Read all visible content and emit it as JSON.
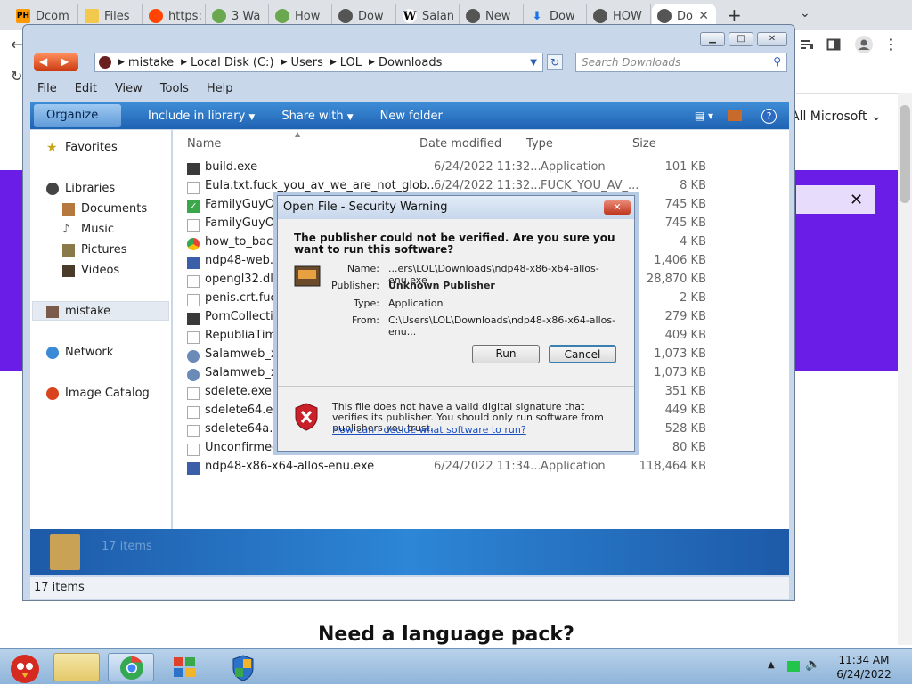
{
  "browser": {
    "tabs": [
      {
        "label": "Dcom",
        "fav": "PH",
        "color": "#ff9900"
      },
      {
        "label": "Files",
        "fav": "folder",
        "color": "#f2c94c"
      },
      {
        "label": "https:",
        "fav": "reddit",
        "color": "#ff4500"
      },
      {
        "label": "3 Wa",
        "fav": "wh",
        "color": "#6aa84f"
      },
      {
        "label": "How",
        "fav": "wh",
        "color": "#6aa84f"
      },
      {
        "label": "Dow",
        "fav": "globe",
        "color": "#555555"
      },
      {
        "label": "Salan",
        "fav": "W",
        "color": "#ffffff"
      },
      {
        "label": "New",
        "fav": "globe",
        "color": "#555555"
      },
      {
        "label": "Dow",
        "fav": "download",
        "color": "#1a73e8"
      },
      {
        "label": "HOW",
        "fav": "globe",
        "color": "#555555"
      },
      {
        "label": "Do",
        "fav": "globe",
        "color": "#555555",
        "active": true
      }
    ],
    "new_tab": "+",
    "page": {
      "all_microsoft": "All Microsoft",
      "banner_close": "✕",
      "language_pack": "Need a language pack?"
    }
  },
  "explorer": {
    "breadcrumb": [
      "mistake",
      "Local Disk (C:)",
      "Users",
      "LOL",
      "Downloads"
    ],
    "search_placeholder": "Search Downloads",
    "menu": [
      "File",
      "Edit",
      "View",
      "Tools",
      "Help"
    ],
    "toolbar": {
      "organize": "Organize",
      "include": "Include in library",
      "share": "Share with",
      "new_folder": "New folder"
    },
    "nav": {
      "favorites": "Favorites",
      "libraries": "Libraries",
      "documents": "Documents",
      "music": "Music",
      "pictures": "Pictures",
      "videos": "Videos",
      "mistake": "mistake",
      "network": "Network",
      "image_catalog": "Image Catalog"
    },
    "columns": {
      "name": "Name",
      "date": "Date modified",
      "type": "Type",
      "size": "Size"
    },
    "files": [
      {
        "name": "build.exe",
        "date": "6/24/2022 11:32...",
        "type": "Application",
        "size": "101 KB"
      },
      {
        "name": "Eula.txt.fuck_you_av_we_are_not_glob...",
        "date": "6/24/2022 11:32...",
        "type": "FUCK_YOU_AV_...",
        "size": "8 KB"
      },
      {
        "name": "FamilyGuyOpt",
        "date": "",
        "type": "",
        "size": "745 KB"
      },
      {
        "name": "FamilyGuyOpt",
        "date": "",
        "type": "",
        "size": "745 KB"
      },
      {
        "name": "how_to_back_",
        "date": "",
        "type": "",
        "size": "4 KB"
      },
      {
        "name": "ndp48-web.ex",
        "date": "",
        "type": "",
        "size": "1,406 KB"
      },
      {
        "name": "opengl32.dll.f",
        "date": "",
        "type": "",
        "size": "28,870 KB"
      },
      {
        "name": "penis.crt.fuck_",
        "date": "",
        "type": "",
        "size": "2 KB"
      },
      {
        "name": "PornCollection",
        "date": "",
        "type": "",
        "size": "279 KB"
      },
      {
        "name": "RepubliaTime",
        "date": "",
        "type": "",
        "size": "409 KB"
      },
      {
        "name": "Salamweb_x8",
        "date": "",
        "type": "",
        "size": "1,073 KB"
      },
      {
        "name": "Salamweb_x8",
        "date": "",
        "type": "",
        "size": "1,073 KB"
      },
      {
        "name": "sdelete.exe.fu",
        "date": "",
        "type": "",
        "size": "351 KB"
      },
      {
        "name": "sdelete64.exe",
        "date": "",
        "type": "",
        "size": "449 KB"
      },
      {
        "name": "sdelete64a.ex",
        "date": "",
        "type": "",
        "size": "528 KB"
      },
      {
        "name": "Unconfirmed",
        "date": "",
        "type": "",
        "size": "80 KB"
      },
      {
        "name": "ndp48-x86-x64-allos-enu.exe",
        "date": "6/24/2022 11:34...",
        "type": "Application",
        "size": "118,464 KB"
      }
    ],
    "details_count": "17 items",
    "status": "17 items"
  },
  "dialog": {
    "title": "Open File - Security Warning",
    "close": "✕",
    "question": "The publisher could not be verified.  Are you sure you want to run this software?",
    "name_label": "Name:",
    "name_value": "...ers\\LOL\\Downloads\\ndp48-x86-x64-allos-enu.exe",
    "publisher_label": "Publisher:",
    "publisher_value": "Unknown Publisher",
    "type_label": "Type:",
    "type_value": "Application",
    "from_label": "From:",
    "from_value": "C:\\Users\\LOL\\Downloads\\ndp48-x86-x64-allos-enu...",
    "run": "Run",
    "cancel": "Cancel",
    "warning": "This file does not have a valid digital signature that verifies its publisher.  You should only run software from publishers you trust.",
    "link": "How can I decide what software to run?"
  },
  "taskbar": {
    "time": "11:34 AM",
    "date": "6/24/2022"
  }
}
